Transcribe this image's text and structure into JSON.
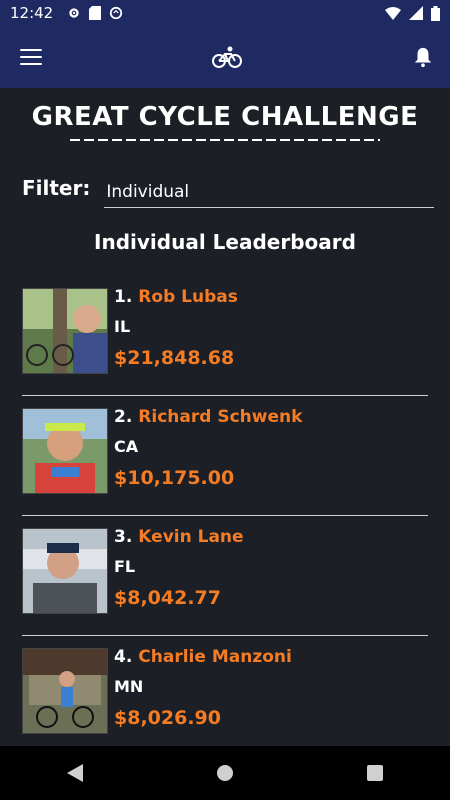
{
  "status_bar": {
    "time": "12:42",
    "left_icons": [
      "gear-icon",
      "sd-card-icon",
      "sync-icon"
    ],
    "right_icons": [
      "wifi-icon",
      "signal-icon",
      "battery-icon"
    ]
  },
  "app_bar": {
    "menu_icon": "hamburger-menu-icon",
    "center_icon": "bicycle-icon",
    "right_icon": "bell-icon",
    "bar_color": "#1f2a63"
  },
  "brand": {
    "title": "GREAT CYCLE CHALLENGE"
  },
  "filter": {
    "label": "Filter:",
    "value": "Individual"
  },
  "leaderboard": {
    "title": "Individual Leaderboard",
    "accent_color": "#f47c24",
    "entries": [
      {
        "rank": "1.",
        "name": "Rob Lubas",
        "state": "IL",
        "amount": "$21,848.68"
      },
      {
        "rank": "2.",
        "name": "Richard Schwenk",
        "state": "CA",
        "amount": "$10,175.00"
      },
      {
        "rank": "3.",
        "name": "Kevin Lane",
        "state": "FL",
        "amount": "$8,042.77"
      },
      {
        "rank": "4.",
        "name": "Charlie Manzoni",
        "state": "MN",
        "amount": "$8,026.90"
      }
    ]
  },
  "nav_bar": {
    "back_icon": "back-triangle-icon",
    "home_icon": "home-circle-icon",
    "recents_icon": "recents-square-icon"
  }
}
